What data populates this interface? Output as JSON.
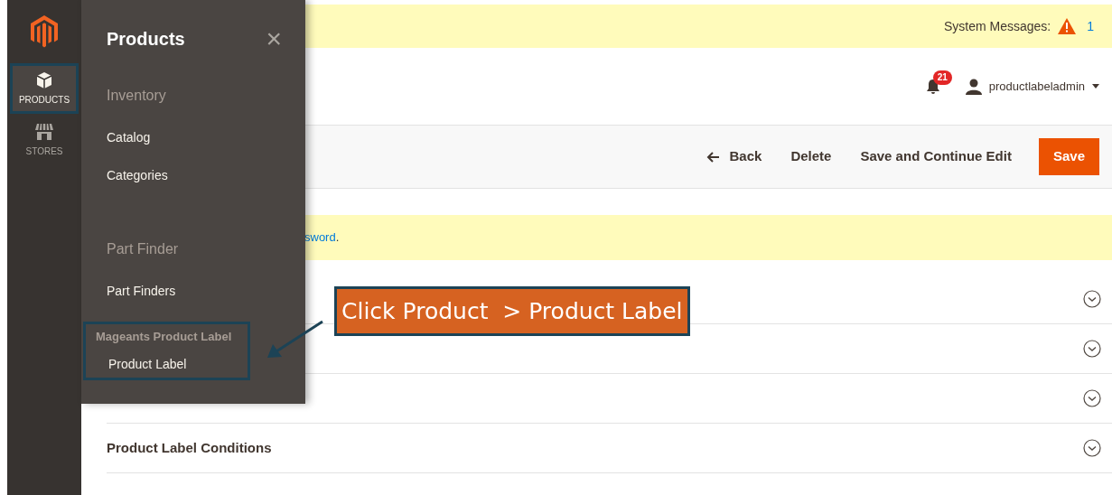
{
  "sidebar": {
    "items": [
      {
        "label": "PRODUCTS",
        "kind": "box",
        "selected": true
      },
      {
        "label": "STORES",
        "kind": "store",
        "selected": false
      }
    ]
  },
  "flyout": {
    "title": "Products",
    "close": "×",
    "groups": [
      {
        "heading": "Inventory",
        "items": [
          "Catalog",
          "Categories"
        ],
        "highlighted": false
      },
      {
        "heading": "Part Finder",
        "items": [
          "Part Finders"
        ],
        "highlighted": false
      },
      {
        "heading": "Mageants Product Label",
        "items": [
          "Product Label"
        ],
        "highlighted": true
      }
    ]
  },
  "system_messages": {
    "label": "System Messages:",
    "count": "1"
  },
  "header": {
    "notifications": "21",
    "user": "productlabeladmin"
  },
  "actions": [
    {
      "label": "Back",
      "kind": "back"
    },
    {
      "label": "Delete",
      "kind": "plain"
    },
    {
      "label": "Save and Continue Edit",
      "kind": "plain"
    },
    {
      "label": "Save",
      "kind": "primary"
    }
  ],
  "notice": {
    "link": "sword",
    "after": "."
  },
  "sections": [
    {
      "expanded": false
    },
    {
      "expanded": false
    },
    {
      "expanded": false
    },
    {
      "title": "Product Label Conditions",
      "expanded": false
    }
  ],
  "callout": {
    "text": "Click Product  > Product Label"
  }
}
